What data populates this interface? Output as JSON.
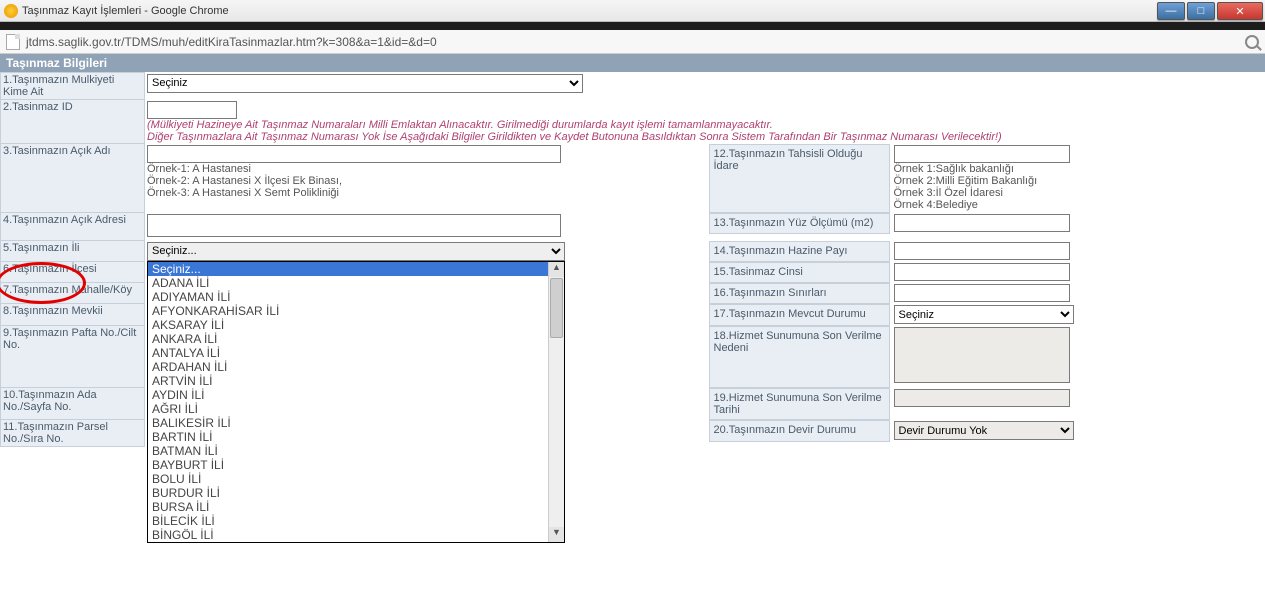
{
  "window": {
    "title": "Taşınmaz Kayıt İşlemleri - Google Chrome",
    "url": "jtdms.saglik.gov.tr/TDMS/muh/editKiraTasinmazlar.htm?k=308&a=1&id=&d=0"
  },
  "section_title": "Taşınmaz Bilgileri",
  "labels": {
    "l1": "1.Taşınmazın Mulkiyeti Kime Ait",
    "l2": "2.Tasinmaz ID",
    "l3": "3.Tasinmazın Açık Adı",
    "l4": "4.Taşınmazın Açık Adresi",
    "l5": "5.Taşınmazın İli",
    "l6": "6.Taşınmazın İlçesi",
    "l7": "7.Taşınmazın Mahalle/Köy",
    "l8": "8.Taşınmazın Mevkii",
    "l9": "9.Taşınmazın Pafta No./Cilt No.",
    "l10": "10.Taşınmazın Ada No./Sayfa No.",
    "l11": "11.Taşınmazın Parsel No./Sıra No.",
    "l12": "12.Taşınmazın Tahsisli Olduğu İdare",
    "l13": "13.Taşınmazın Yüz Ölçümü (m2)",
    "l14": "14.Taşınmazın Hazine Payı",
    "l15": "15.Tasinmaz Cinsi",
    "l16": "16.Taşınmazın Sınırları",
    "l17": "17.Taşınmazın Mevcut Durumu",
    "l18": "18.Hizmet Sunumuna Son Verilme Nedeni",
    "l19": "19.Hizmet Sunumuna Son Verilme Tarihi",
    "l20": "20.Taşınmazın Devir Durumu"
  },
  "hints": {
    "id1": "(Mülkiyeti Hazineye Ait Taşınmaz Numaraları Milli Emlaktan Alınacaktır. Girilmediği durumlarda kayıt işlemi tamamlanmayacaktır.",
    "id2": "Diğer Taşınmazlara Ait Taşınmaz Numarası Yok İse Aşağıdaki Bilgiler Girildikten ve Kaydet Butonuna Basıldıktan Sonra Sistem Tarafından Bir Taşınmaz Numarası Verilecektir!)",
    "ex1": "Örnek-1: A Hastanesi",
    "ex2": "Örnek-2: A Hastanesi X İlçesi Ek Binası,",
    "ex3": "Örnek-3: A Hastanesi X Semt Polikliniği",
    "rex1": "Örnek 1:Sağlık bakanlığı",
    "rex2": "Örnek 2:Milli Eğitim Bakanlığı",
    "rex3": "Örnek 3:İl Özel İdaresi",
    "rex4": "Örnek 4:Belediye"
  },
  "selects": {
    "owner": "Seçiniz",
    "province_value": "Seçiniz...",
    "status": "Seçiniz",
    "devir": "Devir Durumu Yok"
  },
  "province_options": [
    "Seçiniz...",
    "ADANA İLİ",
    "ADIYAMAN İLİ",
    "AFYONKARAHİSAR İLİ",
    "AKSARAY İLİ",
    "ANKARA İLİ",
    "ANTALYA İLİ",
    "ARDAHAN İLİ",
    "ARTVİN İLİ",
    "AYDIN İLİ",
    "AĞRI İLİ",
    "BALIKESİR İLİ",
    "BARTIN İLİ",
    "BATMAN İLİ",
    "BAYBURT İLİ",
    "BOLU İLİ",
    "BURDUR İLİ",
    "BURSA İLİ",
    "BİLECİK İLİ",
    "BİNGÖL İLİ"
  ]
}
